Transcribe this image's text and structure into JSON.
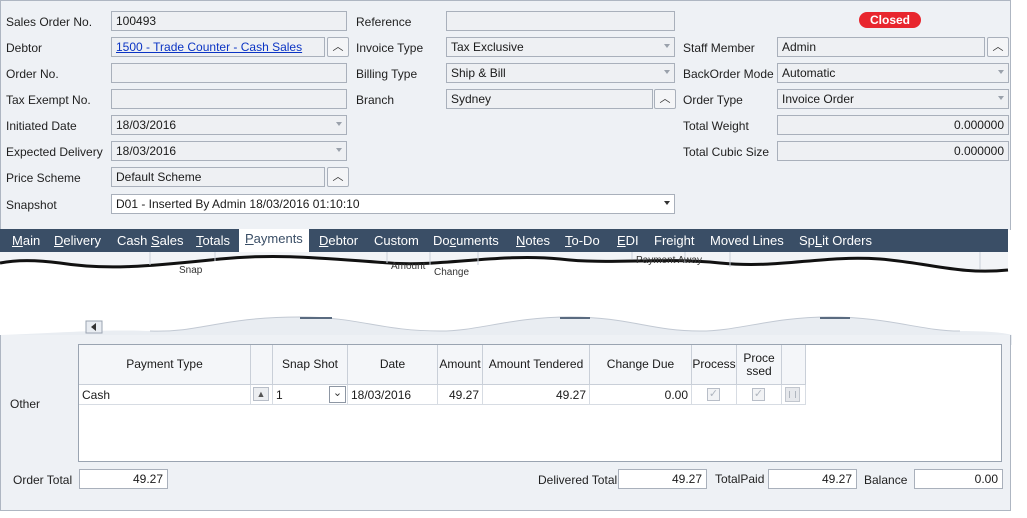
{
  "order": {
    "status": "Closed",
    "sales_order_no": {
      "label": "Sales Order No.",
      "value": "100493"
    },
    "debtor": {
      "label": "Debtor",
      "value": "1500 - Trade Counter - Cash Sales"
    },
    "order_no": {
      "label": "Order No.",
      "value": ""
    },
    "tax_exempt_no": {
      "label": "Tax Exempt No.",
      "value": ""
    },
    "initiated_date": {
      "label": "Initiated Date",
      "value": "18/03/2016"
    },
    "expected_delivery": {
      "label": "Expected Delivery",
      "value": "18/03/2016"
    },
    "price_scheme": {
      "label": "Price Scheme",
      "value": "Default Scheme"
    },
    "snapshot": {
      "label": "Snapshot",
      "value": "D01 - Inserted By Admin 18/03/2016 01:10:10"
    },
    "reference": {
      "label": "Reference",
      "value": ""
    },
    "invoice_type": {
      "label": "Invoice Type",
      "value": "Tax Exclusive"
    },
    "billing_type": {
      "label": "Billing Type",
      "value": "Ship & Bill"
    },
    "branch": {
      "label": "Branch",
      "value": "Sydney"
    },
    "staff_member": {
      "label": "Staff Member",
      "value": "Admin"
    },
    "backorder_mode": {
      "label": "BackOrder Mode",
      "value": "Automatic"
    },
    "order_type": {
      "label": "Order Type",
      "value": "Invoice Order"
    },
    "total_weight": {
      "label": "Total Weight",
      "value": "0.000000"
    },
    "total_cubic_size": {
      "label": "Total Cubic Size",
      "value": "0.000000"
    }
  },
  "tabs": [
    {
      "pre": "",
      "u": "M",
      "post": "ain"
    },
    {
      "pre": "",
      "u": "D",
      "post": "elivery"
    },
    {
      "pre": "Cash ",
      "u": "S",
      "post": "ales"
    },
    {
      "pre": "",
      "u": "T",
      "post": "otals"
    },
    {
      "pre": "",
      "u": "P",
      "post": "ayments"
    },
    {
      "pre": "",
      "u": "D",
      "post": "ebtor"
    },
    {
      "pre": "Custom",
      "u": "",
      "post": ""
    },
    {
      "pre": "Do",
      "u": "c",
      "post": "uments"
    },
    {
      "pre": "",
      "u": "N",
      "post": "otes"
    },
    {
      "pre": "",
      "u": "T",
      "post": "o-Do"
    },
    {
      "pre": "",
      "u": "E",
      "post": "DI"
    },
    {
      "pre": "Freight",
      "u": "",
      "post": ""
    },
    {
      "pre": "Moved Lines",
      "u": "",
      "post": ""
    },
    {
      "pre": "Sp",
      "u": "L",
      "post": "it Orders"
    }
  ],
  "torn_fragments": {
    "snap": "Snap",
    "amount": "Amount",
    "change": "Change",
    "payment_away": "Payment Away"
  },
  "payments": {
    "section_label": "Other",
    "columns": [
      "Payment Type",
      "Snap Shot",
      "Date",
      "Amount",
      "Amount Tendered",
      "Change Due",
      "Process",
      "Processed"
    ],
    "rows": [
      {
        "payment_type": "Cash",
        "snap_shot": "1",
        "date": "18/03/2016",
        "amount": "49.27",
        "amount_tendered": "49.27",
        "change_due": "0.00",
        "process": true,
        "processed": true
      }
    ]
  },
  "totals": {
    "order_total": {
      "label": "Order Total",
      "value": "49.27"
    },
    "delivered_total": {
      "label": "Delivered Total",
      "value": "49.27"
    },
    "total_paid": {
      "label": "TotalPaid",
      "value": "49.27"
    },
    "balance": {
      "label": "Balance",
      "value": "0.00"
    }
  },
  "colors": {
    "tab_bar": "#3a4e66",
    "status_badge": "#e8262e",
    "link": "#0b34c4"
  }
}
